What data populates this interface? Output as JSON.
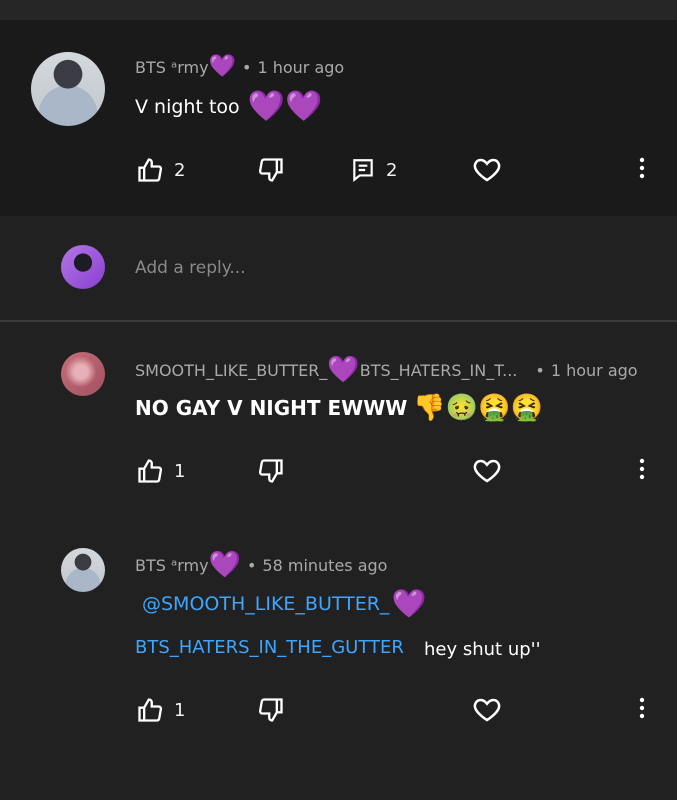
{
  "comment1": {
    "author": "BTS ᵃrmy",
    "author_heart": "💜",
    "time": "1 hour ago",
    "text": "V night too",
    "text_emoji": "💜💜",
    "likes": "2",
    "replies": "2"
  },
  "reply_box": {
    "placeholder": "Add a reply..."
  },
  "reply1": {
    "author_a": "SMOOTH_LIKE_BUTTER_",
    "author_heart": "💜",
    "author_b": "BTS_HATERS_IN_T...",
    "time": "1 hour ago",
    "text": "NO GAY V NIGHT EWWW",
    "text_emoji": "👎🤢🤮🤮",
    "likes": "1"
  },
  "reply2": {
    "author": "BTS ᵃrmy",
    "author_heart": "💜",
    "time": "58 minutes ago",
    "mention": "@SMOOTH_LIKE_BUTTER_",
    "mention_heart": "💜",
    "mention_line2": "BTS_HATERS_IN_THE_GUTTER",
    "text": "hey shut up''",
    "likes": "1"
  },
  "icons": {
    "like": "thumbs-up-icon",
    "dislike": "thumbs-down-icon",
    "reply": "comment-icon",
    "heart": "heart-icon",
    "more": "more-vertical-icon"
  }
}
